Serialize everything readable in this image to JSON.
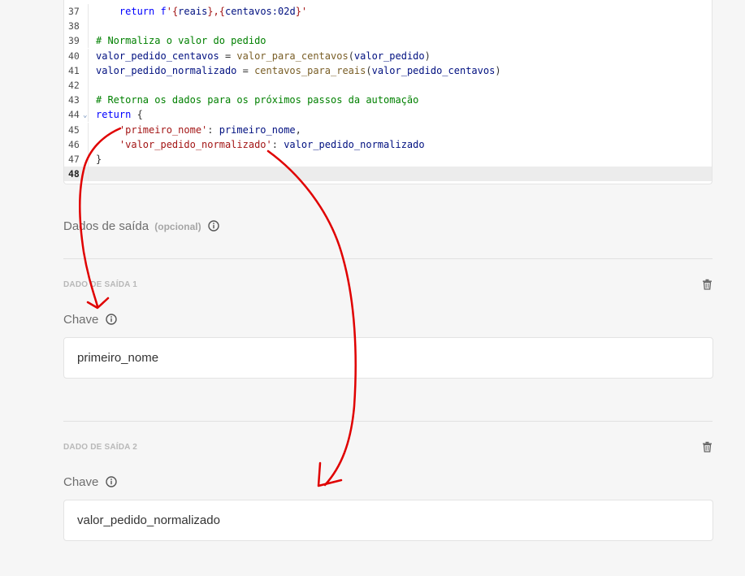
{
  "editor": {
    "lines": [
      {
        "num": "37",
        "tokens": [
          {
            "t": "    "
          },
          {
            "t": "return",
            "c": "kw"
          },
          {
            "t": " f",
            "c": "kw"
          },
          {
            "t": "'{",
            "c": "str"
          },
          {
            "t": "reais",
            "c": "var"
          },
          {
            "t": "},{",
            "c": "str"
          },
          {
            "t": "centavos",
            "c": "var"
          },
          {
            "t": ":02d",
            "c": "var"
          },
          {
            "t": "}'",
            "c": "str"
          }
        ]
      },
      {
        "num": "38",
        "tokens": []
      },
      {
        "num": "39",
        "tokens": [
          {
            "t": "# Normaliza o valor do pedido",
            "c": "cm"
          }
        ]
      },
      {
        "num": "40",
        "tokens": [
          {
            "t": "valor_pedido_centavos",
            "c": "var"
          },
          {
            "t": " = ",
            "c": "op"
          },
          {
            "t": "valor_para_centavos",
            "c": "fn"
          },
          {
            "t": "(",
            "c": "op"
          },
          {
            "t": "valor_pedido",
            "c": "var"
          },
          {
            "t": ")",
            "c": "op"
          }
        ]
      },
      {
        "num": "41",
        "tokens": [
          {
            "t": "valor_pedido_normalizado",
            "c": "var"
          },
          {
            "t": " = ",
            "c": "op"
          },
          {
            "t": "centavos_para_reais",
            "c": "fn"
          },
          {
            "t": "(",
            "c": "op"
          },
          {
            "t": "valor_pedido_centavos",
            "c": "var"
          },
          {
            "t": ")",
            "c": "op"
          }
        ]
      },
      {
        "num": "42",
        "tokens": []
      },
      {
        "num": "43",
        "tokens": [
          {
            "t": "# Retorna os dados para os próximos passos da automação",
            "c": "cm"
          }
        ]
      },
      {
        "num": "44",
        "fold": true,
        "tokens": [
          {
            "t": "return",
            "c": "kw"
          },
          {
            "t": " {",
            "c": "op"
          }
        ]
      },
      {
        "num": "45",
        "tokens": [
          {
            "t": "    "
          },
          {
            "t": "'primeiro_nome'",
            "c": "str"
          },
          {
            "t": ": ",
            "c": "op"
          },
          {
            "t": "primeiro_nome",
            "c": "var"
          },
          {
            "t": ",",
            "c": "op"
          }
        ]
      },
      {
        "num": "46",
        "tokens": [
          {
            "t": "    "
          },
          {
            "t": "'valor_pedido_normalizado'",
            "c": "str"
          },
          {
            "t": ": ",
            "c": "op"
          },
          {
            "t": "valor_pedido_normalizado",
            "c": "var"
          }
        ]
      },
      {
        "num": "47",
        "tokens": [
          {
            "t": "}",
            "c": "op"
          }
        ]
      },
      {
        "num": "48",
        "active": true,
        "tokens": []
      }
    ]
  },
  "output": {
    "title": "Dados de saída",
    "optional": "(opcional)",
    "items": [
      {
        "label": "DADO DE SAÍDA 1",
        "key_label": "Chave",
        "value": "primeiro_nome"
      },
      {
        "label": "DADO DE SAÍDA 2",
        "key_label": "Chave",
        "value": "valor_pedido_normalizado"
      }
    ]
  },
  "colors": {
    "annotation": "#e00000",
    "keyword": "#0000ff",
    "comment": "#008000",
    "string": "#a31515"
  },
  "icons": [
    "chevron-down-icon",
    "info-icon",
    "trash-icon"
  ]
}
